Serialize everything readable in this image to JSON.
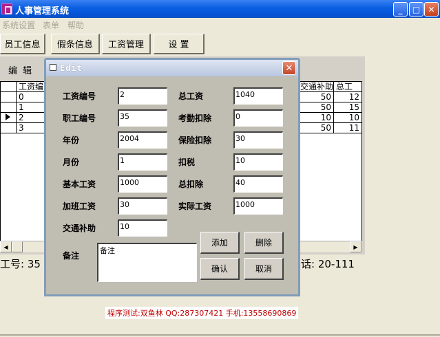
{
  "window": {
    "title": "人事管理系统",
    "minimize": "_",
    "maximize": "□",
    "close": "✕"
  },
  "menu": [
    "系统设置",
    "表单",
    "帮助"
  ],
  "toolbar": [
    "员工信息",
    "假条信息",
    "工资管理",
    "设  置"
  ],
  "edit_label": "编  辑",
  "grid": {
    "left_headers": [
      "工资编"
    ],
    "left_rows": [
      "0",
      "1",
      "2",
      "3"
    ],
    "right_headers": [
      "交通补助",
      "总工"
    ],
    "right_rows": [
      [
        "50",
        "12"
      ],
      [
        "50",
        "15"
      ],
      [
        "10",
        "10"
      ],
      [
        "50",
        "11"
      ]
    ],
    "selected_row": 2
  },
  "status": {
    "left": "工号: 35",
    "right": "话: 20-111"
  },
  "credit": "程序测试:双鱼林 QQ:287307421 手机:13558690869",
  "dialog": {
    "title": "Edit",
    "fields_left": [
      {
        "label": "工资编号",
        "value": "2"
      },
      {
        "label": "职工编号",
        "value": "35"
      },
      {
        "label": "年份",
        "value": "2004"
      },
      {
        "label": "月份",
        "value": "1"
      },
      {
        "label": "基本工资",
        "value": "1000"
      },
      {
        "label": "加班工资",
        "value": "30"
      },
      {
        "label": "交通补助",
        "value": "10"
      }
    ],
    "fields_right": [
      {
        "label": "总工资",
        "value": "1040"
      },
      {
        "label": "考勤扣除",
        "value": "0"
      },
      {
        "label": "保险扣除",
        "value": "30"
      },
      {
        "label": "扣税",
        "value": "10"
      },
      {
        "label": "总扣除",
        "value": "40"
      },
      {
        "label": "实际工资",
        "value": "1000"
      }
    ],
    "remark_label": "备注",
    "remark_value": "备注",
    "buttons": {
      "add": "添加",
      "delete": "删除",
      "confirm": "确认",
      "cancel": "取消"
    }
  }
}
